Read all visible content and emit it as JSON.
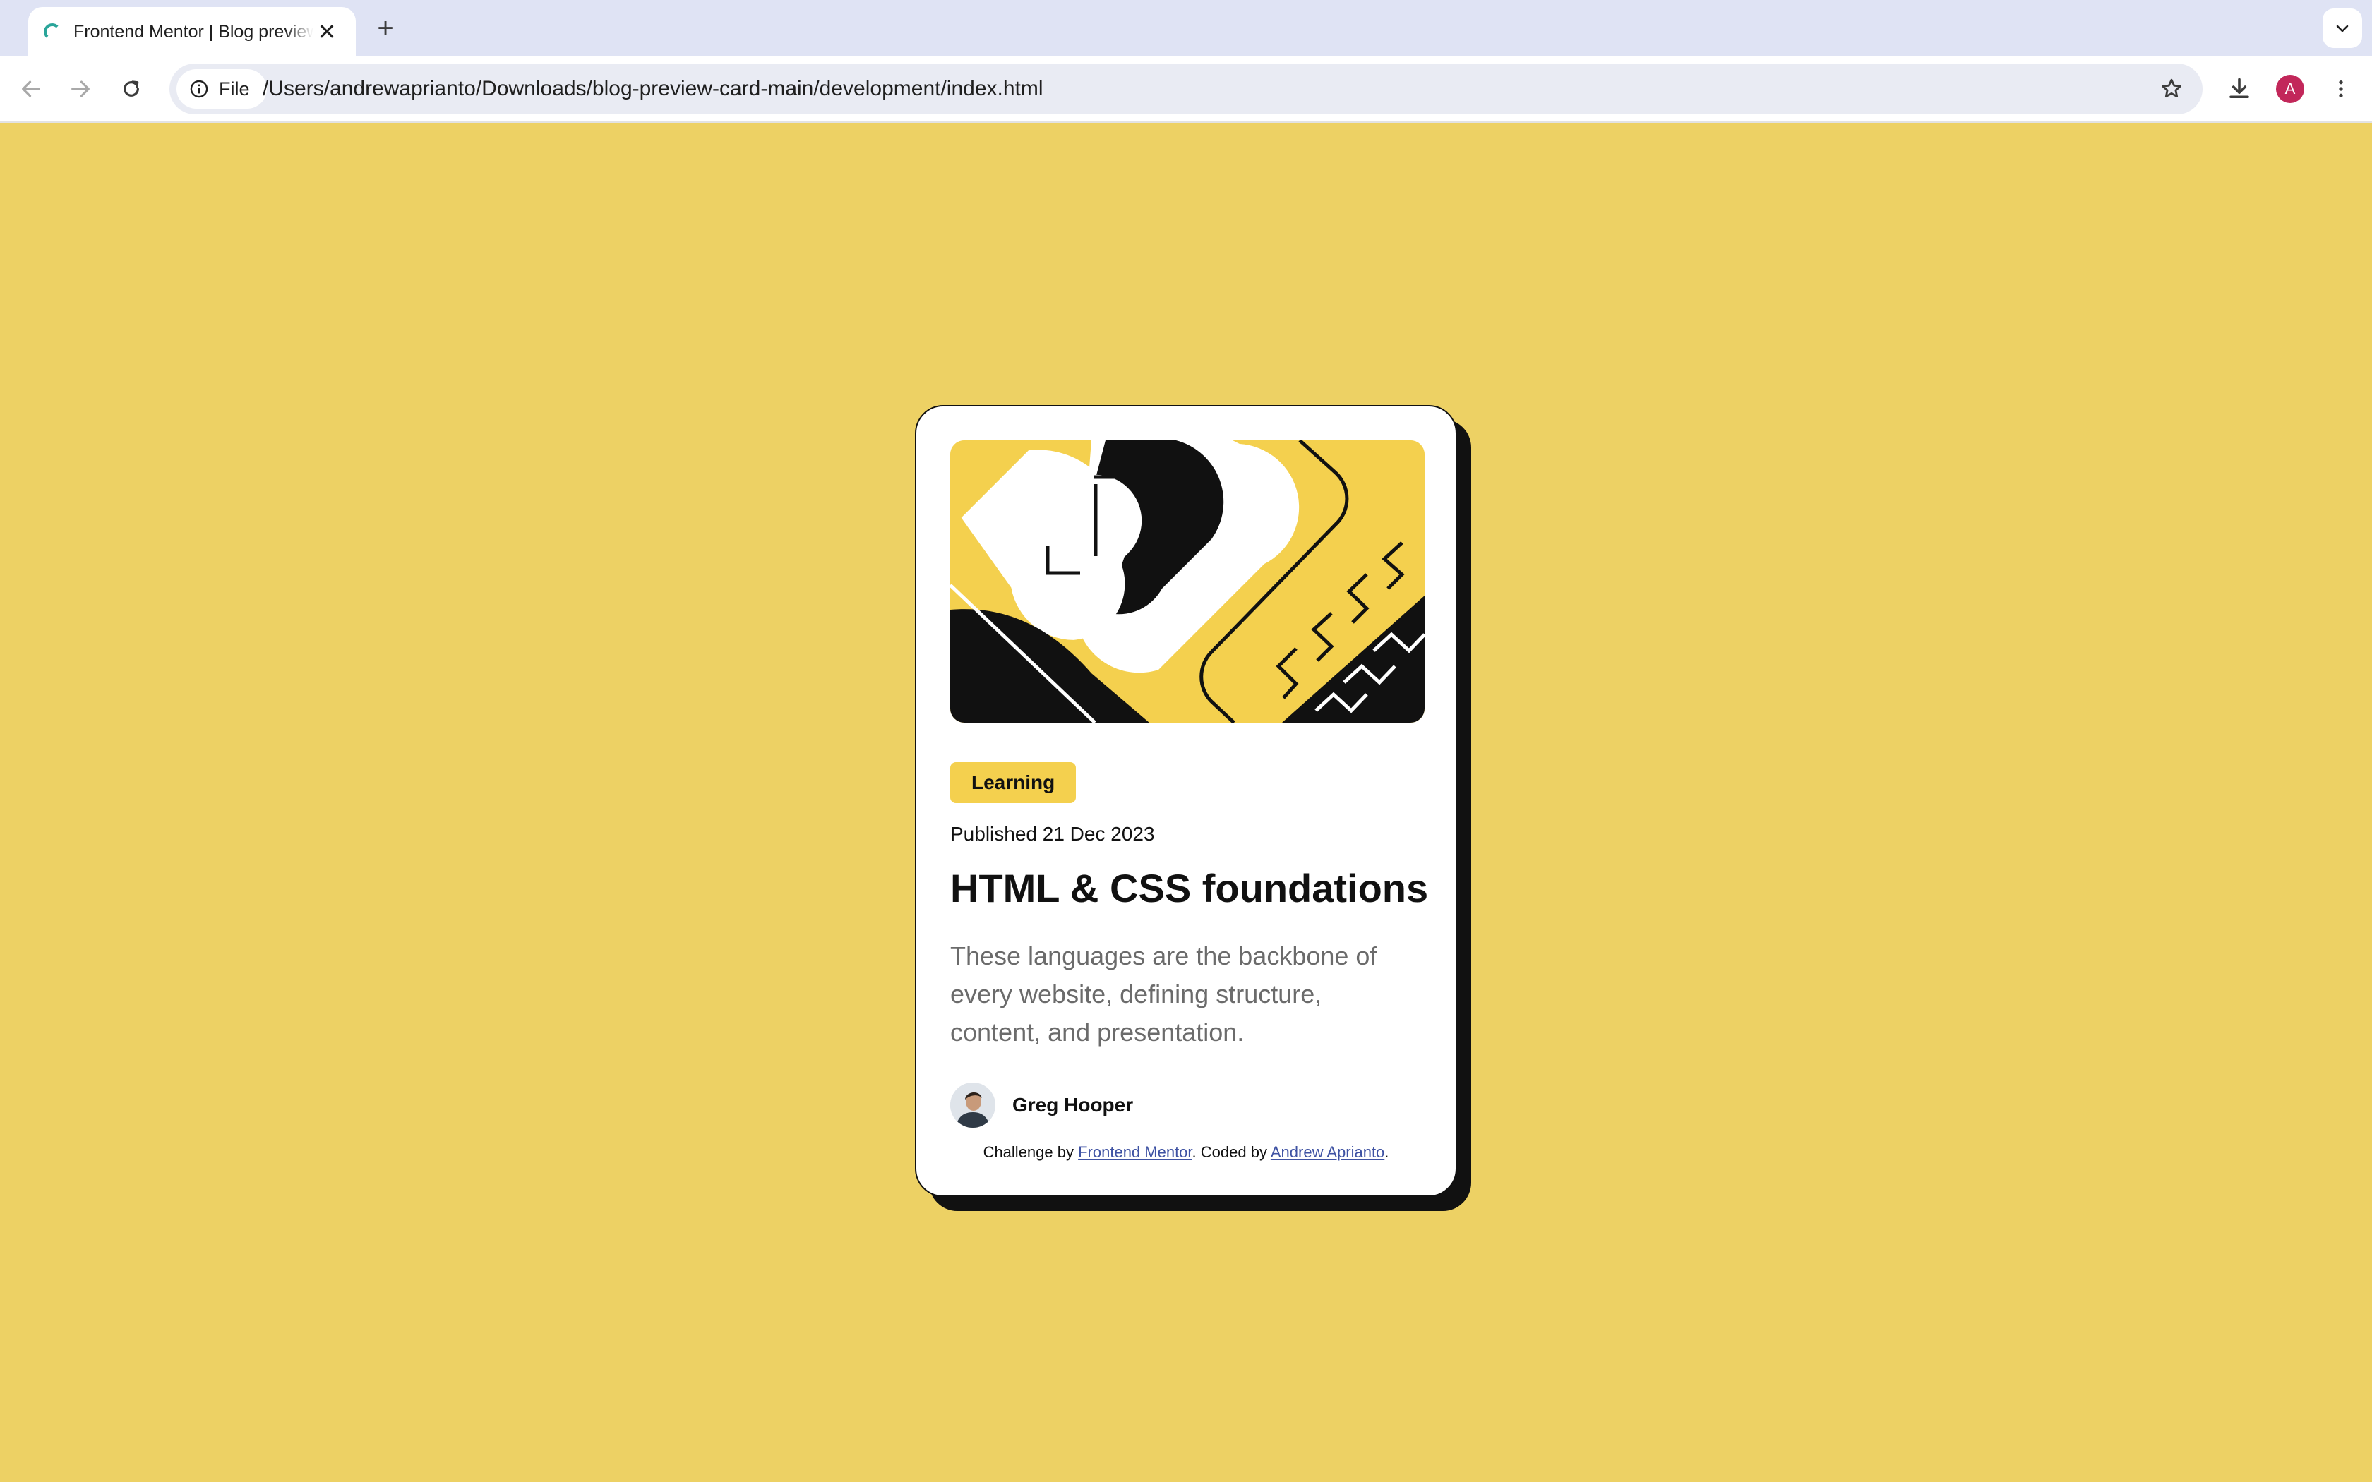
{
  "browser": {
    "tab": {
      "title": "Frontend Mentor | Blog preview card",
      "close_glyph": "✕"
    },
    "new_tab_glyph": "+",
    "omnibox": {
      "site_chip_label": "File",
      "url": "/Users/andrewaprianto/Downloads/blog-preview-card-main/development/index.html"
    },
    "profile_initial": "A",
    "colors": {
      "tabstrip": "#dfe3f4",
      "toolbar": "#ffffff",
      "omnibox": "#e9ebf3",
      "profile_avatar": "#c2275a"
    }
  },
  "page": {
    "background": "#edd164",
    "card": {
      "image_icon": "blog-illustration",
      "tag": "Learning",
      "published": "Published 21 Dec 2023",
      "title": "HTML & CSS foundations",
      "excerpt": "These languages are the backbone of every website, defining structure, content, and presentation.",
      "author": {
        "name": "Greg Hooper",
        "avatar_icon": "author-avatar"
      },
      "attribution": {
        "prefix": "Challenge by ",
        "challenge_link": "Frontend Mentor",
        "middle": ". Coded by ",
        "coder_link": "Andrew Aprianto",
        "suffix": "."
      },
      "colors": {
        "accent": "#f4d04e",
        "text": "#111111",
        "muted": "#6b6b6b",
        "link": "#3e52a3"
      }
    }
  }
}
